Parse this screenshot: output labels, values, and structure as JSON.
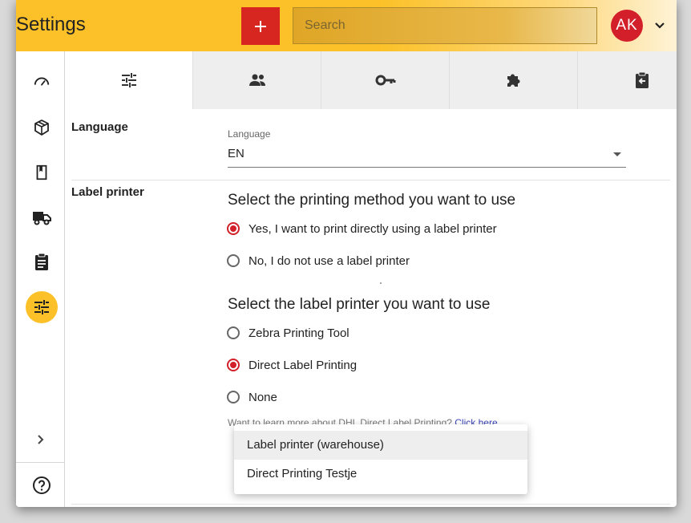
{
  "header": {
    "title": "Settings",
    "search_placeholder": "Search",
    "avatar_initials": "AK",
    "accent_color": "#fcc128",
    "action_color": "#d7261f"
  },
  "sidebar": {
    "items": [
      {
        "icon": "speedometer-icon"
      },
      {
        "icon": "package-icon"
      },
      {
        "icon": "book-icon"
      },
      {
        "icon": "truck-icon"
      },
      {
        "icon": "clipboard-icon"
      },
      {
        "icon": "sliders-icon",
        "active": true
      }
    ],
    "bottom": [
      {
        "icon": "chevron-right-icon"
      },
      {
        "icon": "help-icon"
      }
    ]
  },
  "tabs": [
    {
      "icon": "sliders-icon",
      "active": true
    },
    {
      "icon": "people-icon"
    },
    {
      "icon": "key-icon"
    },
    {
      "icon": "puzzle-icon"
    },
    {
      "icon": "clipboard-return-icon"
    }
  ],
  "language": {
    "section_label": "Language",
    "field_label": "Language",
    "value": "EN"
  },
  "label_printer": {
    "section_label": "Label printer",
    "method_question": "Select the printing method you want to use",
    "method_options": [
      {
        "label": "Yes, I want to print directly using a label printer",
        "checked": true
      },
      {
        "label": "No, I do not use a label printer",
        "checked": false
      }
    ],
    "printer_question": "Select the label printer you want to use",
    "printer_options": [
      {
        "label": "Zebra Printing Tool",
        "checked": false
      },
      {
        "label": "Direct Label Printing",
        "checked": true
      },
      {
        "label": "None",
        "checked": false
      }
    ],
    "learn_more_text": "Want to learn more about DHL Direct Label Printing?",
    "learn_more_link": "Click here"
  },
  "printer_menu": {
    "items": [
      {
        "label": "Label printer (warehouse)",
        "highlighted": true
      },
      {
        "label": "Direct Printing Testje",
        "highlighted": false
      }
    ]
  }
}
